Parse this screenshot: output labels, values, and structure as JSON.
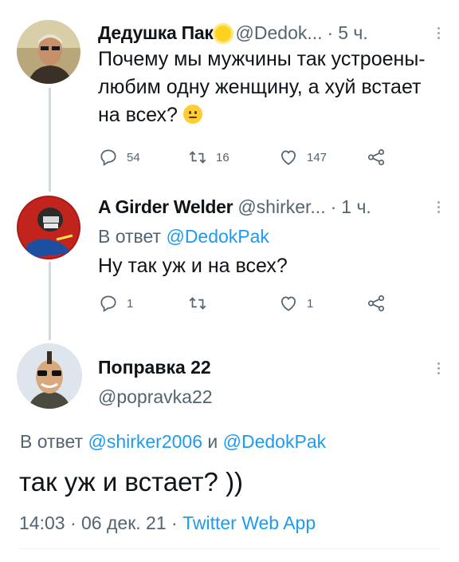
{
  "tweets": [
    {
      "name": "Дедушка Пак",
      "handle": "@Dedok...",
      "sep": "·",
      "time": "5 ч.",
      "text": "Почему мы мужчины так устроены-любим одну женщину, а хуй встает на всех?",
      "actions": {
        "reply": "54",
        "retweet": "16",
        "like": "147"
      }
    },
    {
      "name": "A Girder Welder",
      "handle": "@shirker...",
      "sep": "·",
      "time": "1 ч.",
      "reply_prefix": "В ответ",
      "reply_to": "@DedokPak",
      "text": "Ну так уж и на всех?",
      "actions": {
        "reply": "1",
        "retweet": "",
        "like": "1"
      }
    }
  ],
  "main": {
    "name": "Поправка 22",
    "handle": "@popravka22",
    "reply_prefix": "В ответ",
    "reply_to_1": "@shirker2006",
    "reply_and": "и",
    "reply_to_2": "@DedokPak",
    "text": "так уж и встает? ))",
    "time": "14:03",
    "sep": "·",
    "date": "06 дек. 21",
    "source": "Twitter Web App"
  },
  "colors": {
    "accent": "#1d9bf0",
    "secondary": "#536471",
    "line": "#cfd9de"
  },
  "icons": [
    "reply-icon",
    "retweet-icon",
    "like-icon",
    "share-icon",
    "more-icon",
    "thinking-emoji",
    "sun-emoji"
  ]
}
